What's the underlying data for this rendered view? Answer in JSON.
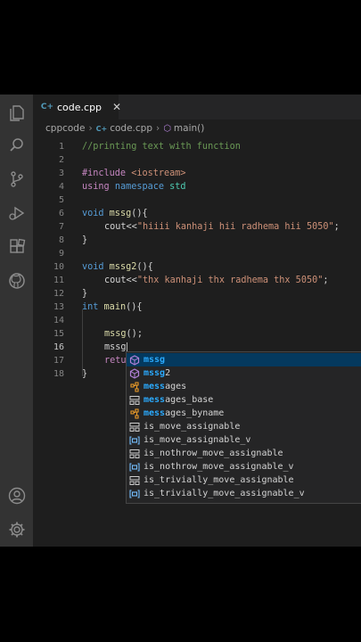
{
  "tab": {
    "icon": "cpp-file-icon",
    "label": "code.cpp",
    "close": "✕"
  },
  "breadcrumb": {
    "folder": "cppcode",
    "file": "code.cpp",
    "symbol": "main()"
  },
  "lines": [
    {
      "n": "1"
    },
    {
      "n": "2"
    },
    {
      "n": "3"
    },
    {
      "n": "4"
    },
    {
      "n": "5"
    },
    {
      "n": "6"
    },
    {
      "n": "7"
    },
    {
      "n": "8"
    },
    {
      "n": "9"
    },
    {
      "n": "10"
    },
    {
      "n": "11"
    },
    {
      "n": "12"
    },
    {
      "n": "13"
    },
    {
      "n": "14"
    },
    {
      "n": "15"
    },
    {
      "n": "16"
    },
    {
      "n": "17"
    },
    {
      "n": "18"
    }
  ],
  "code": {
    "l1": "//printing text with function",
    "l3_a": "#include ",
    "l3_b": "<iostream>",
    "l4_a": "using ",
    "l4_b": "namespace ",
    "l4_c": "std",
    "l6_a": "void ",
    "l6_b": "mssg",
    "l6_c": "(){",
    "l7_a": "cout<<",
    "l7_b": "\"hiiii kanhaji hii radhema hii 5050\"",
    "l7_c": ";",
    "l8": "}",
    "l10_a": "void ",
    "l10_b": "mssg2",
    "l10_c": "(){",
    "l11_a": "cout<<",
    "l11_b": "\"thx kanhaji thx radhema thx 5050\"",
    "l11_c": ";",
    "l12": "}",
    "l13_a": "int ",
    "l13_b": "main",
    "l13_c": "(){",
    "l15_a": "mssg",
    "l15_b": "();",
    "l16": "mssg",
    "l17": "retu",
    "l18": "}"
  },
  "suggestions": [
    {
      "icon": "method-icon",
      "match": "mssg",
      "rest": "",
      "selected": true
    },
    {
      "icon": "method-icon",
      "match": "mssg",
      "rest": "2"
    },
    {
      "icon": "class-icon",
      "match": "mess",
      "rest": "ages"
    },
    {
      "icon": "struct-icon",
      "match": "mess",
      "rest": "ages_base"
    },
    {
      "icon": "class-icon",
      "match": "mess",
      "rest": "ages_byname"
    },
    {
      "icon": "struct-icon",
      "match": "",
      "rest": "is_move_assignable"
    },
    {
      "icon": "variable-icon",
      "match": "",
      "rest": "is_move_assignable_v"
    },
    {
      "icon": "struct-icon",
      "match": "",
      "rest": "is_nothrow_move_assignable"
    },
    {
      "icon": "variable-icon",
      "match": "",
      "rest": "is_nothrow_move_assignable_v"
    },
    {
      "icon": "struct-icon",
      "match": "",
      "rest": "is_trivially_move_assignable"
    },
    {
      "icon": "variable-icon",
      "match": "",
      "rest": "is_trivially_move_assignable_v"
    }
  ],
  "colors": {
    "accent": "#2aaaff",
    "selection": "#04395e",
    "background": "#1e1e1e"
  }
}
